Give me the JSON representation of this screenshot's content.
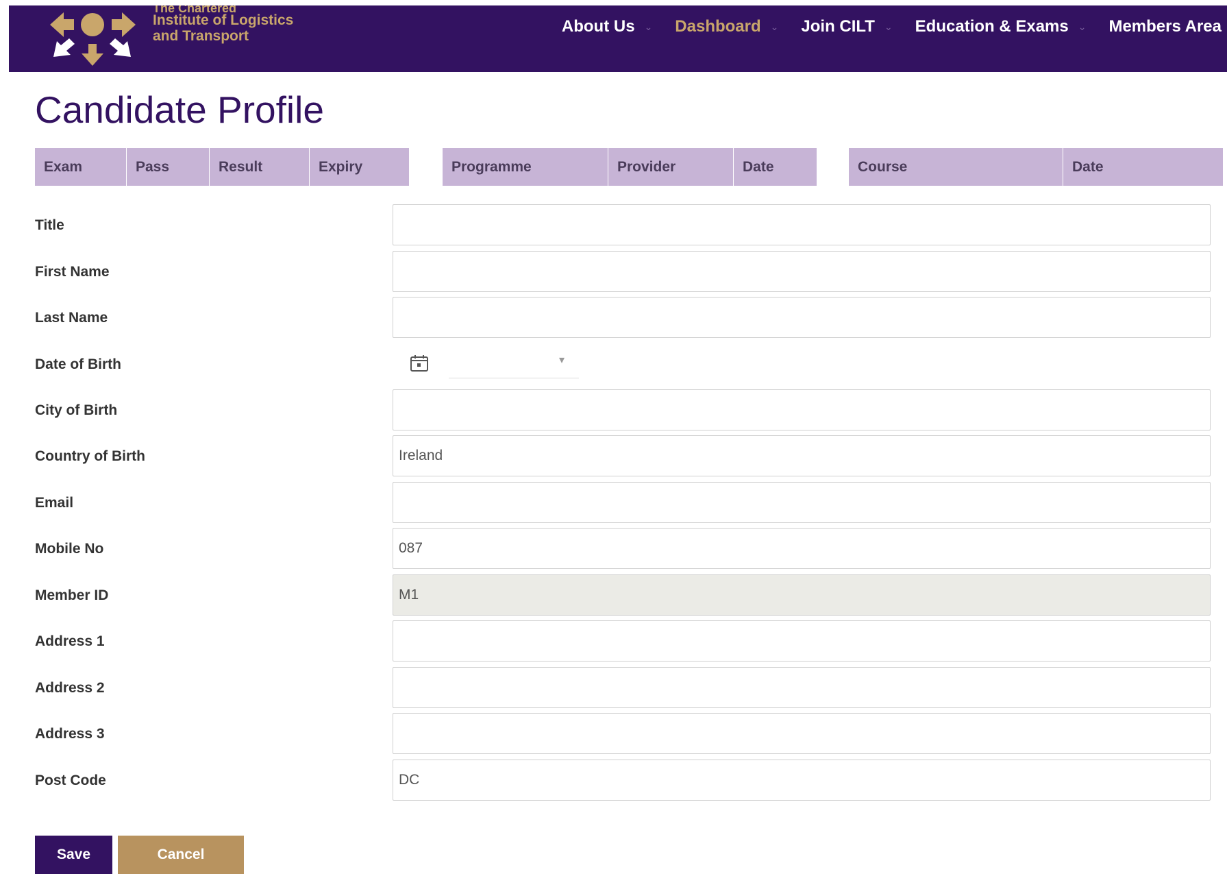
{
  "header": {
    "brand": {
      "line0": "The Chartered",
      "line1": "Institute of Logistics",
      "line2": "and Transport"
    },
    "nav": [
      {
        "label": "About Us",
        "active": false
      },
      {
        "label": "Dashboard",
        "active": true
      },
      {
        "label": "Join CILT",
        "active": false
      },
      {
        "label": "Education & Exams",
        "active": false
      },
      {
        "label": "Members Area",
        "active": false
      }
    ]
  },
  "page_title": "Candidate Profile",
  "tables": {
    "exams": [
      "Exam",
      "Pass",
      "Result",
      "Expiry"
    ],
    "programmes": [
      "Programme",
      "Provider",
      "Date"
    ],
    "courses": [
      "Course",
      "Date"
    ]
  },
  "form": {
    "title": {
      "label": "Title",
      "value": ""
    },
    "first_name": {
      "label": "First Name",
      "value": ""
    },
    "last_name": {
      "label": "Last Name",
      "value": ""
    },
    "dob": {
      "label": "Date of Birth",
      "value": ""
    },
    "city_of_birth": {
      "label": "City of Birth",
      "value": ""
    },
    "country_of_birth": {
      "label": "Country of Birth",
      "value": "Ireland"
    },
    "email": {
      "label": "Email",
      "value": ""
    },
    "mobile": {
      "label": "Mobile No",
      "value": "087"
    },
    "member_id": {
      "label": "Member ID",
      "value": "M1"
    },
    "address1": {
      "label": "Address 1",
      "value": ""
    },
    "address2": {
      "label": "Address 2",
      "value": ""
    },
    "address3": {
      "label": "Address 3",
      "value": ""
    },
    "post_code": {
      "label": "Post Code",
      "value": "DC"
    }
  },
  "buttons": {
    "save": "Save",
    "cancel": "Cancel"
  },
  "colors": {
    "primary": "#331261",
    "gold": "#c9a66b",
    "table_header": "#c7b4d6"
  }
}
